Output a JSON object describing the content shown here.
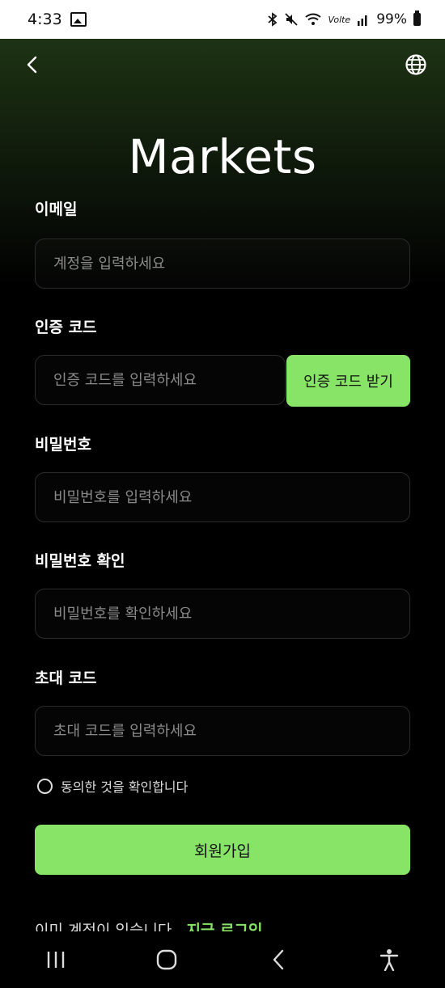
{
  "status_bar": {
    "time": "4:33",
    "network": "Volte",
    "battery": "99%"
  },
  "header": {
    "title": "Markets"
  },
  "form": {
    "email": {
      "label": "이메일",
      "placeholder": "계정을 입력하세요"
    },
    "code": {
      "label": "인증 코드",
      "placeholder": "인증 코드를 입력하세요",
      "button": "인증 코드 받기"
    },
    "password": {
      "label": "비밀번호",
      "placeholder": "비밀번호를 입력하세요"
    },
    "password_confirm": {
      "label": "비밀번호 확인",
      "placeholder": "비밀번호를 확인하세요"
    },
    "invite": {
      "label": "초대 코드",
      "placeholder": "초대 코드를 입력하세요"
    },
    "agree": "동의한 것을 확인합니다",
    "submit": "회원가입"
  },
  "footer": {
    "has_account": "이미 계정이 있습니다.",
    "login_link": "지금 로그인"
  },
  "colors": {
    "accent": "#88e466",
    "background": "#000000",
    "header_tint": "#1d3314"
  },
  "icons": {
    "back": "chevron-left-icon",
    "language": "globe-icon",
    "nav_recents": "recents-icon",
    "nav_home": "home-icon",
    "nav_back": "back-icon",
    "accessibility": "accessibility-icon"
  }
}
